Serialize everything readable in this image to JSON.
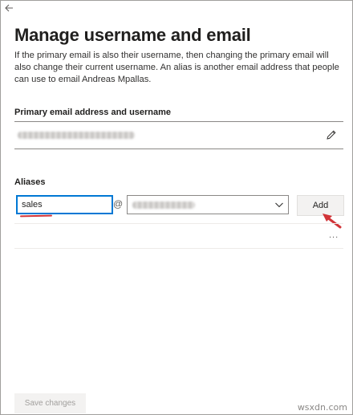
{
  "header": {
    "back_icon": "arrow-left-icon",
    "title": "Manage username and email",
    "description": "If the primary email is also their username, then changing the primary email will also change their current username. An alias is another email address that people can use to email Andreas Mpallas."
  },
  "primary": {
    "label": "Primary email address and username",
    "edit_icon": "pencil-icon"
  },
  "aliases": {
    "label": "Aliases",
    "alias_value": "sales",
    "at_sign": "@",
    "add_label": "Add",
    "more_label": "..."
  },
  "footer": {
    "save_label": "Save changes",
    "watermark": "wsxdn.com"
  },
  "colors": {
    "accent": "#0078d4",
    "annotation_red": "#d13438"
  }
}
